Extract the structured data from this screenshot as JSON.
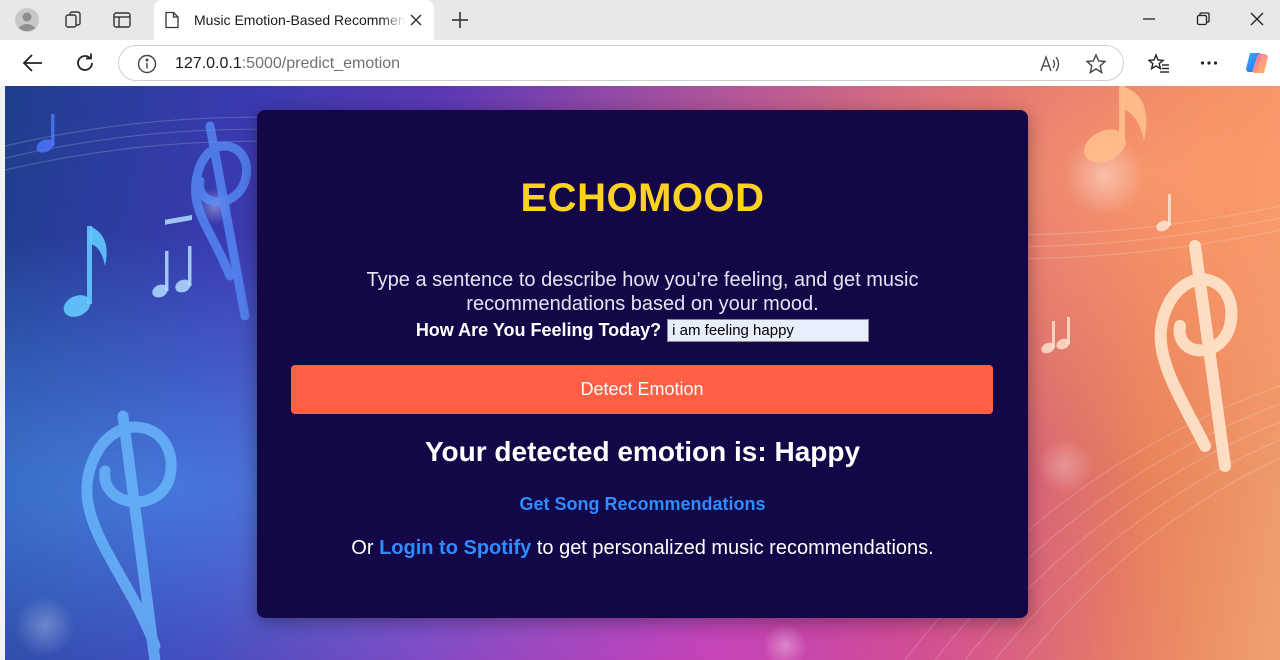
{
  "browser": {
    "tab_title": "Music Emotion-Based Recommender",
    "url_host": "127.0.0.1",
    "url_rest": ":5000/predict_emotion"
  },
  "page": {
    "brand": "ECHOMOOD",
    "intro": "Type a sentence to describe how you're feeling, and get music recommendations based on your mood.",
    "feeling_label": "How Are You Feeling Today?",
    "feeling_value": "i am feeling happy",
    "detect_button": "Detect Emotion",
    "result": "Your detected emotion is: Happy",
    "recs_link": "Get Song Recommendations",
    "spotify_prefix": "Or",
    "spotify_link": "Login to Spotify",
    "spotify_suffix": "to get personalized music recommendations."
  },
  "colors": {
    "card_bg": "#130748",
    "brand_yellow": "#ffd21f",
    "button_orange": "#ff5f45",
    "link_blue": "#2f8cff"
  },
  "icons": [
    "profile-icon",
    "workspaces-icon",
    "tab-actions-icon",
    "page-icon",
    "close-icon",
    "plus-icon",
    "minimize-icon",
    "restore-icon",
    "back-arrow-icon",
    "reload-icon",
    "info-icon",
    "read-aloud-icon",
    "star-icon",
    "favorites-icon",
    "more-icon",
    "copilot-icon"
  ]
}
